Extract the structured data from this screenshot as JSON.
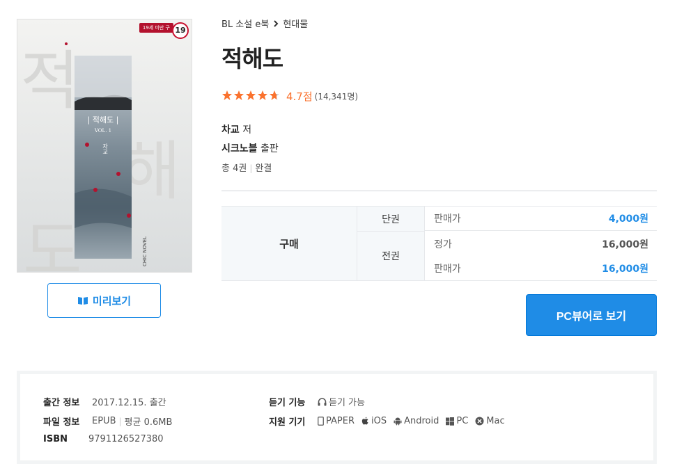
{
  "cover": {
    "age_strip": "19세 미만 구",
    "age_rating": "19",
    "art_title": "| 적해도 |",
    "art_vol": "VOL. 1",
    "art_author": "자교",
    "publisher_logo": "CHIC NOVEL"
  },
  "preview_button": {
    "icon": "book-icon",
    "label": "미리보기"
  },
  "breadcrumb": {
    "category": "BL 소설 e북",
    "chevron": "›",
    "subcategory": "현대물"
  },
  "title": "적해도",
  "rating": {
    "stars": 4.7,
    "score_text": "4.7점",
    "count_text": "(14,341명)"
  },
  "author": {
    "name": "차교",
    "suffix": "저"
  },
  "publisher": {
    "name": "시크노블",
    "suffix": "출판"
  },
  "volumes": {
    "total": "총 4권",
    "status": "완결"
  },
  "price_table": {
    "buy_label": "구매",
    "single_label": "단권",
    "all_label": "전권",
    "single_sale_label": "판매가",
    "single_sale_value": "4,000원",
    "all_list_label": "정가",
    "all_list_value": "16,000원",
    "all_sale_label": "판매가",
    "all_sale_value": "16,000원"
  },
  "viewer_button": "PC뷰어로 보기",
  "info": {
    "pub_label": "출간 정보",
    "pub_value": "2017.12.15. 출간",
    "file_label": "파일 정보",
    "file_format": "EPUB",
    "file_size": "평균 0.6MB",
    "isbn_label": "ISBN",
    "isbn_value": "9791126527380",
    "listen_label": "듣기 기능",
    "listen_value": "듣기 가능",
    "devices_label": "지원 기기",
    "devices": [
      "PAPER",
      "iOS",
      "Android",
      "PC",
      "Mac"
    ]
  },
  "colors": {
    "accent": "#1f8ce6",
    "star": "#fa722e",
    "badge_red": "#c8102e"
  }
}
